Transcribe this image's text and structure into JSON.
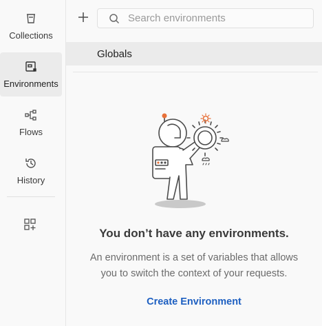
{
  "sidebar": {
    "items": [
      {
        "label": "Collections",
        "icon": "trash-can-collections-icon"
      },
      {
        "label": "Environments",
        "icon": "environment-icon",
        "active": true
      },
      {
        "label": "Flows",
        "icon": "flows-icon"
      },
      {
        "label": "History",
        "icon": "history-icon"
      }
    ],
    "add_workspace_icon": "add-apps-icon"
  },
  "main": {
    "search": {
      "placeholder": "Search environments",
      "value": ""
    },
    "globals_label": "Globals",
    "empty_state": {
      "title": "You don’t have any environments.",
      "description_line1": "An environment is a set of variables that allows",
      "description_line2": "you to switch the context of your requests.",
      "cta": "Create Environment"
    }
  },
  "colors": {
    "accent_link": "#1d5fc1",
    "active_bg": "#ebebeb",
    "illustration_orange": "#e8713a"
  }
}
